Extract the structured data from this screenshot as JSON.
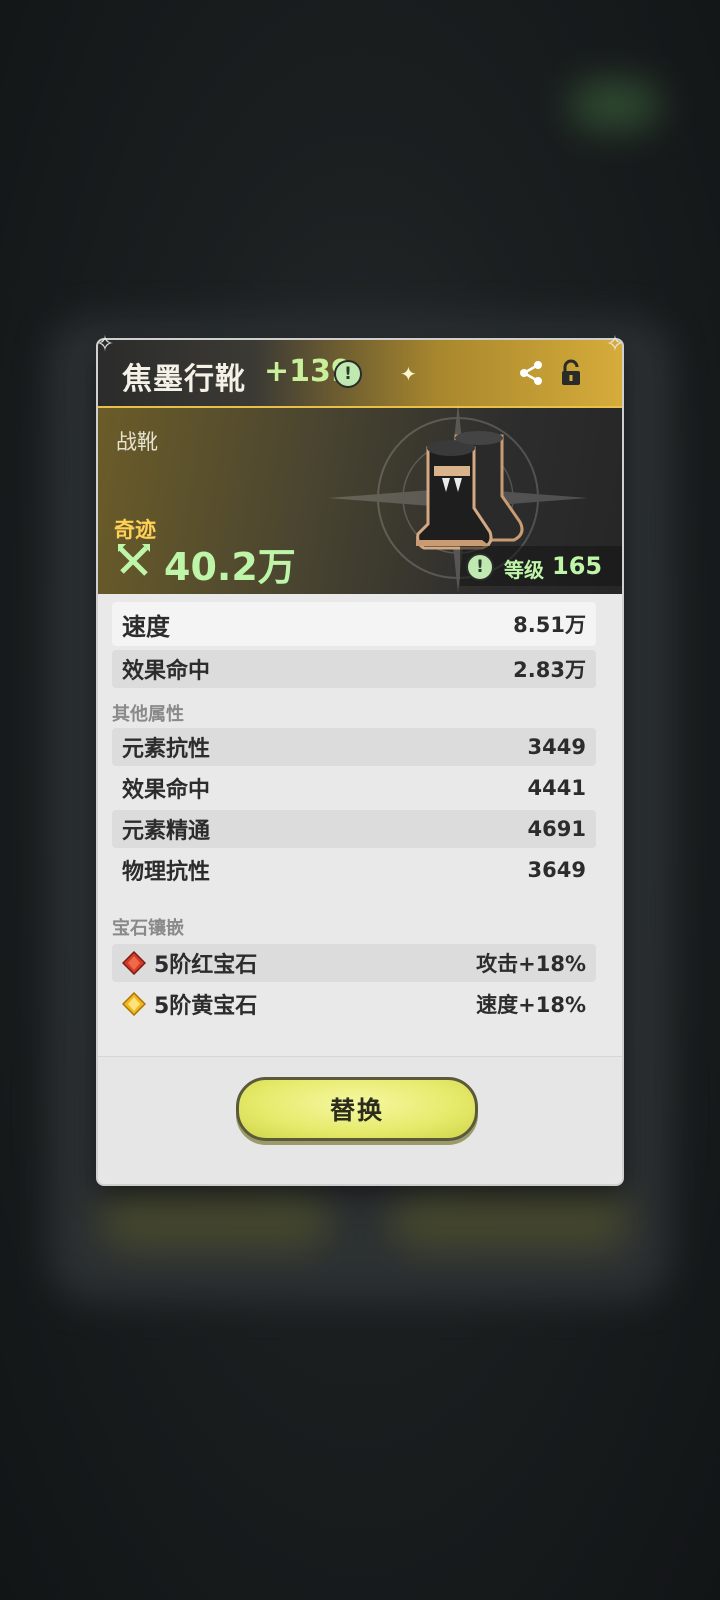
{
  "item": {
    "name": "焦墨行靴",
    "enhance": "+139",
    "type": "战靴",
    "rarity": "奇迹",
    "power": "40.2万",
    "level_label": "等级",
    "level_value": "165"
  },
  "main_stats": [
    {
      "label": "速度",
      "value": "8.51万"
    },
    {
      "label": "效果命中",
      "value": "2.83万"
    }
  ],
  "other_stats_title": "其他属性",
  "other_stats": [
    {
      "label": "元素抗性",
      "value": "3449"
    },
    {
      "label": "效果命中",
      "value": "4441"
    },
    {
      "label": "元素精通",
      "value": "4691"
    },
    {
      "label": "物理抗性",
      "value": "3649"
    }
  ],
  "gems_title": "宝石镶嵌",
  "gems": [
    {
      "name": "5阶红宝石",
      "effect": "攻击+18%",
      "icon": "red-gem-icon",
      "color": "#d23a2a"
    },
    {
      "name": "5阶黄宝石",
      "effect": "速度+18%",
      "icon": "yellow-gem-icon",
      "color": "#f2b61e"
    }
  ],
  "replace_button": "替换",
  "colors": {
    "accent_gold": "#e6c048",
    "power_green": "#bff5a8",
    "button_yellow": "#e6ea6a"
  }
}
